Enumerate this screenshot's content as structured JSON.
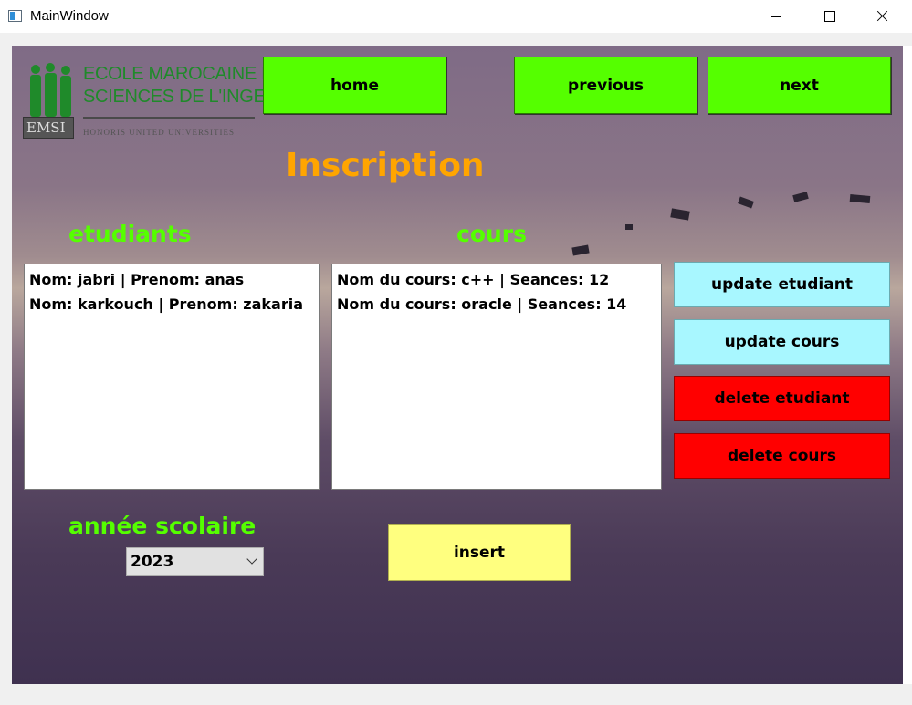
{
  "window": {
    "title": "MainWindow"
  },
  "logo": {
    "line1": "ECOLE MAROCAINE DES",
    "line2": "SCIENCES DE L'INGENIEUR",
    "badge": "EMSI",
    "tagline": "HONORIS UNITED UNIVERSITIES"
  },
  "nav": {
    "home": "home",
    "previous": "previous",
    "next": "next"
  },
  "page": {
    "title": "Inscription"
  },
  "students": {
    "heading": "etudiants",
    "items": [
      "Nom: jabri | Prenom: anas",
      "Nom: karkouch | Prenom: zakaria"
    ]
  },
  "courses": {
    "heading": "cours",
    "items": [
      "Nom du cours: c++ | Seances: 12",
      "Nom du cours: oracle | Seances: 14"
    ]
  },
  "actions": {
    "update_student": "update etudiant",
    "update_course": "update cours",
    "delete_student": "delete etudiant",
    "delete_course": "delete cours",
    "insert": "insert"
  },
  "year": {
    "label": "année scolaire",
    "selected": "2023"
  },
  "colors": {
    "nav_button": "#55ff00",
    "title": "#ffa500",
    "heading": "#55ff00",
    "update_button": "#a8f7ff",
    "delete_button": "#ff0000",
    "insert_button": "#ffff7f"
  }
}
